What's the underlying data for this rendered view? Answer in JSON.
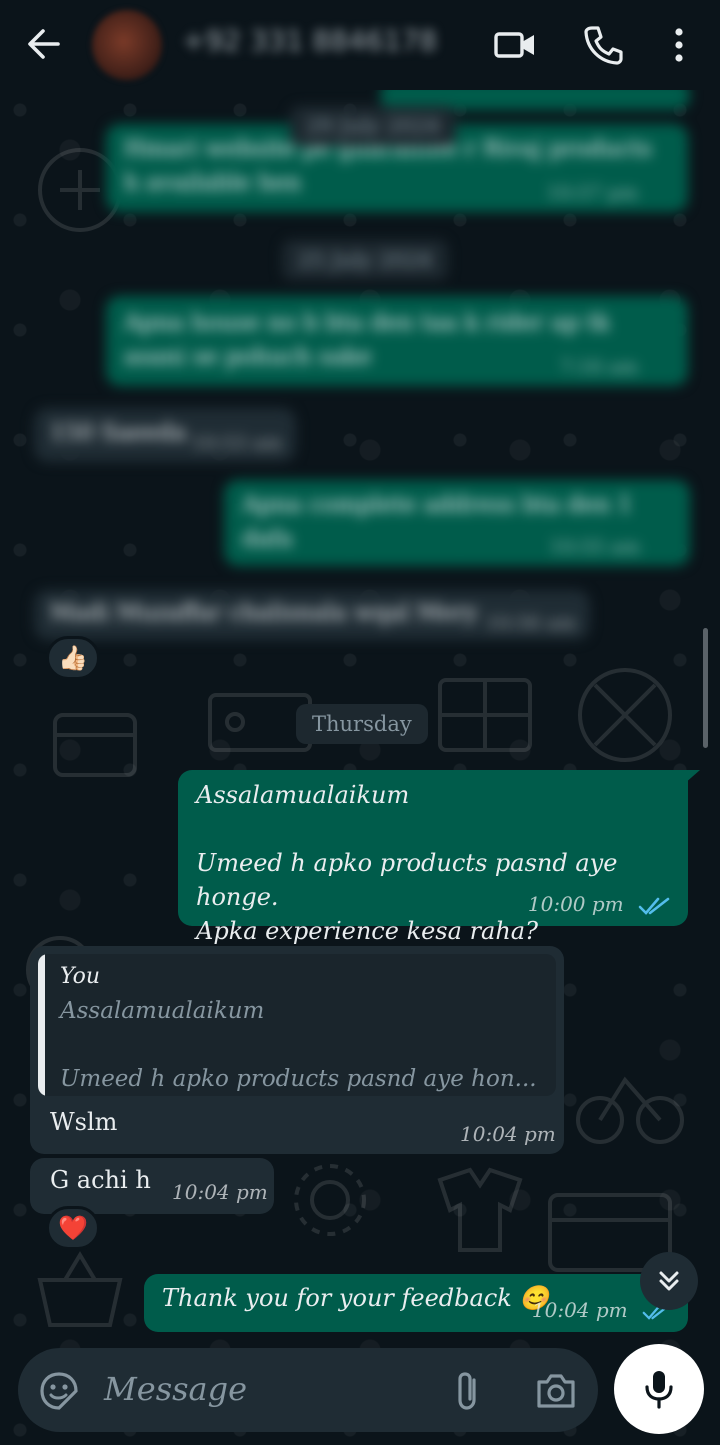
{
  "header": {
    "contact_name": "+92 331 8846178",
    "icons": [
      "back-arrow-icon",
      "video-call-icon",
      "voice-call-icon",
      "more-options-icon"
    ]
  },
  "history": {
    "msg1_text": "Hmari website pe guarantee r Rivaj products h available hen",
    "msg1_time": "10:57 pm",
    "date1": "29 July 2024",
    "date2": "25 July 2024",
    "msg2_text": "Apna house no b bta den taa k rider ap tk asani se pohuch sake",
    "msg2_time": "7:16 am",
    "msg3_text": "150 Saeeda",
    "msg3_time": "10:53 am",
    "msg4_text": "Apna complete address bta den 1 dafa",
    "msg4_time": "10:55 am",
    "msg5_text": "Madi Muzaffar chalisnala wqal Mery",
    "msg5_time": "10:56 am",
    "msg5_reaction": "👍🏻"
  },
  "date_separator": "Thursday",
  "messages": {
    "out1_line1": "Assalamualaikum",
    "out1_line2": "Umeed h apko products pasnd aye honge.",
    "out1_line3": "Apka experience kesa raha?",
    "out1_time": "10:00 pm",
    "reply_author": "You",
    "reply_line1": "Assalamualaikum",
    "reply_line2": "Umeed h apko products pasnd aye hon...",
    "in1_text": "Wslm",
    "in1_time": "10:04 pm",
    "in2_text": "G achi h",
    "in2_time": "10:04 pm",
    "in2_reaction": "❤️",
    "out2_text": "Thank you for your feedback 😊",
    "out2_time": "10:04 pm"
  },
  "input": {
    "placeholder": "Message",
    "icons": [
      "sticker-icon",
      "attach-icon",
      "camera-icon",
      "mic-icon"
    ]
  },
  "colors": {
    "background": "#0b141a",
    "outgoing_bubble": "#005c4b",
    "incoming_bubble": "#1f2c34",
    "read_tick": "#53bdeb"
  }
}
